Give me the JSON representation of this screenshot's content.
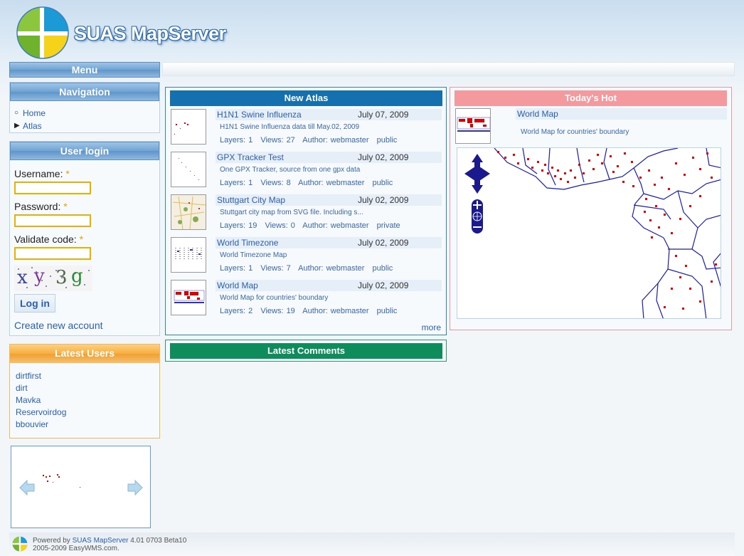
{
  "header": {
    "brand": "SUAS MapServer"
  },
  "menu": {
    "title": "Menu"
  },
  "navigation": {
    "title": "Navigation",
    "items": [
      {
        "label": "Home",
        "bullet": "circle"
      },
      {
        "label": "Atlas",
        "bullet": "triangle"
      }
    ]
  },
  "login": {
    "title": "User login",
    "username_label": "Username:",
    "password_label": "Password:",
    "validate_label": "Validate code:",
    "required_mark": "*",
    "captcha": "xy3g",
    "login_button": "Log in",
    "create_account": "Create new account"
  },
  "latest_users": {
    "title": "Latest Users",
    "users": [
      "dirtfirst",
      "dirt",
      "Mavka",
      "Reservoirdog",
      "bbouvier"
    ]
  },
  "new_atlas": {
    "title": "New Atlas",
    "more": "more",
    "items": [
      {
        "title": "H1N1 Swine Influenza",
        "date": "July 07, 2009",
        "desc": "H1N1 Swine Influenza data till May.02, 2009",
        "layers": "Layers: 1",
        "views": "Views: 27",
        "author": "Author: webmaster",
        "access": "public"
      },
      {
        "title": "GPX Tracker Test",
        "date": "July 02, 2009",
        "desc": "One GPX Tracker, source from one gpx data",
        "layers": "Layers: 1",
        "views": "Views: 8",
        "author": "Author: webmaster",
        "access": "public"
      },
      {
        "title": "Stuttgart City Map",
        "date": "July 02, 2009",
        "desc": "Stuttgart city map from SVG file. Including s...",
        "layers": "Layers: 19",
        "views": "Views: 0",
        "author": "Author: webmaster",
        "access": "private"
      },
      {
        "title": "World Timezone",
        "date": "July 02, 2009",
        "desc": "World Timezone Map",
        "layers": "Layers: 1",
        "views": "Views: 7",
        "author": "Author: webmaster",
        "access": "public"
      },
      {
        "title": "World Map",
        "date": "July 02, 2009",
        "desc": "World Map for countries' boundary",
        "layers": "Layers: 2",
        "views": "Views: 19",
        "author": "Author: webmaster",
        "access": "public"
      }
    ]
  },
  "latest_comments": {
    "title": "Latest Comments"
  },
  "todays_hot": {
    "title": "Today's Hot",
    "item_title": "World Map",
    "item_desc": "World Map for countries' boundary"
  },
  "footer": {
    "powered_prefix": "Powered by",
    "powered_link": "SUAS MapServer",
    "version": "4.01 0703 Beta10",
    "copyright": "2005-2009 EasyWMS.com."
  },
  "colors": {
    "atlas_header": "#1570b0",
    "comments_header": "#0f8c5c",
    "hot_header": "#f49a9e",
    "users_header": "#f0a030",
    "link": "#2a5fb0"
  }
}
